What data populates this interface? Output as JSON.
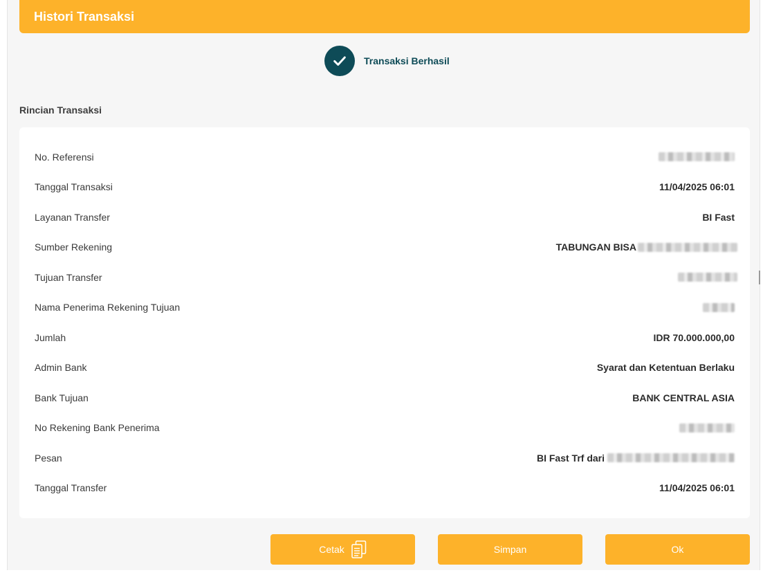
{
  "header": {
    "title": "Histori Transaksi"
  },
  "status": {
    "icon": "check-icon",
    "text": "Transaksi Berhasil"
  },
  "details": {
    "section_title": "Rincian Transaksi",
    "rows": [
      {
        "label": "No. Referensi",
        "value": "",
        "redacted": true
      },
      {
        "label": "Tanggal Transaksi",
        "value": "11/04/2025 06:01",
        "redacted": false
      },
      {
        "label": "Layanan Transfer",
        "value": "BI Fast",
        "redacted": false
      },
      {
        "label": "Sumber Rekening",
        "value": "TABUNGAN BISA",
        "redacted": true
      },
      {
        "label": "Tujuan Transfer",
        "value": "",
        "redacted": true
      },
      {
        "label": "Nama Penerima Rekening Tujuan",
        "value": "",
        "redacted": true
      },
      {
        "label": "Jumlah",
        "value": "IDR 70.000.000,00",
        "redacted": false
      },
      {
        "label": "Admin Bank",
        "value": "Syarat dan Ketentuan Berlaku",
        "redacted": false
      },
      {
        "label": "Bank Tujuan",
        "value": "BANK CENTRAL ASIA",
        "redacted": false
      },
      {
        "label": "No Rekening Bank Penerima",
        "value": "",
        "redacted": true
      },
      {
        "label": "Pesan",
        "value": "BI Fast Trf dari",
        "redacted": true
      },
      {
        "label": "Tanggal Transfer",
        "value": "11/04/2025 06:01",
        "redacted": false
      }
    ]
  },
  "buttons": {
    "print_label": "Cetak",
    "print_icon": "document-copy-icon",
    "save_label": "Simpan",
    "ok_label": "Ok"
  },
  "colors": {
    "accent": "#fdb22a",
    "success": "#0e4b57",
    "background": "#f6f6f6",
    "card": "#ffffff"
  }
}
